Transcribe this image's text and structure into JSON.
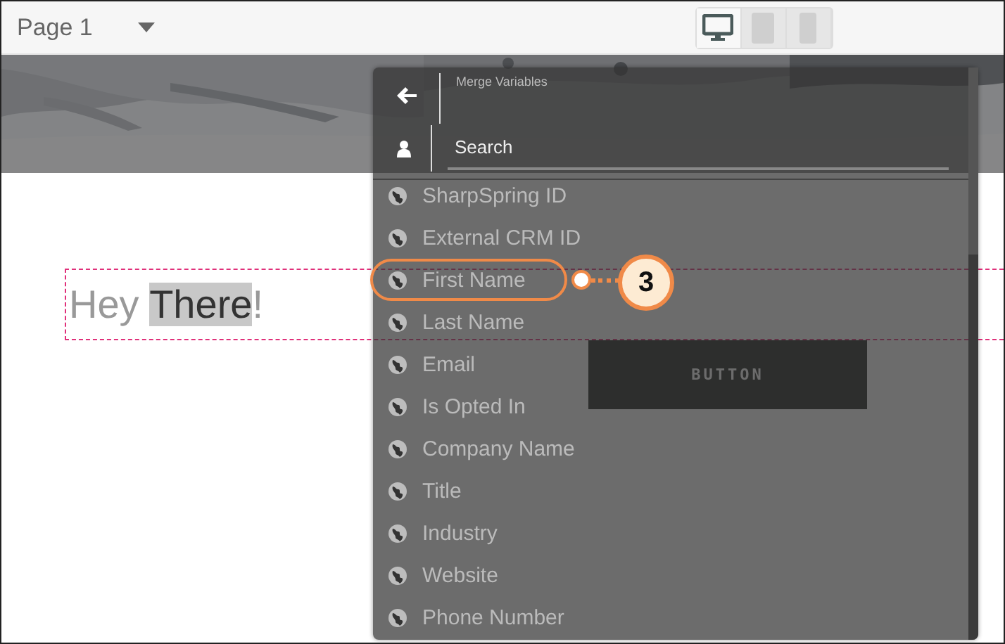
{
  "toolbar": {
    "page_label": "Page 1",
    "devices": [
      {
        "kind": "desktop",
        "selected": true
      },
      {
        "kind": "tablet",
        "selected": false
      },
      {
        "kind": "phone",
        "selected": false
      }
    ]
  },
  "canvas": {
    "heading_parts": [
      {
        "text": "Hey ",
        "selected": false
      },
      {
        "text": "There",
        "selected": true
      },
      {
        "text": "!",
        "selected": false
      }
    ],
    "button_label": "BUTTON"
  },
  "merge_panel": {
    "title": "Merge Variables",
    "search": {
      "placeholder": "Search"
    },
    "items": [
      {
        "label": "SharpSpring ID",
        "highlighted": false
      },
      {
        "label": "External CRM ID",
        "highlighted": false
      },
      {
        "label": "First Name",
        "highlighted": true
      },
      {
        "label": "Last Name",
        "highlighted": false
      },
      {
        "label": "Email",
        "highlighted": false
      },
      {
        "label": "Is Opted In",
        "highlighted": false
      },
      {
        "label": "Company Name",
        "highlighted": false
      },
      {
        "label": "Title",
        "highlighted": false
      },
      {
        "label": "Industry",
        "highlighted": false
      },
      {
        "label": "Website",
        "highlighted": false
      },
      {
        "label": "Phone Number",
        "highlighted": false
      }
    ]
  },
  "callout": {
    "number": "3"
  }
}
